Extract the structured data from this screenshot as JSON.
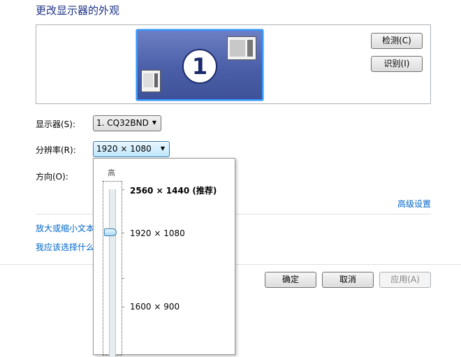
{
  "title": "更改显示器的外观",
  "buttons": {
    "detect": "检测(C)",
    "identify": "识别(I)",
    "ok": "确定",
    "cancel": "取消",
    "apply": "应用(A)"
  },
  "preview": {
    "monitor_number": "1"
  },
  "fields": {
    "display_label": "显示器(S):",
    "display_value": "1. CQ32BND",
    "resolution_label": "分辨率(R):",
    "resolution_value": "1920 × 1080",
    "orientation_label": "方向(O):"
  },
  "links": {
    "advanced": "高级设置",
    "text_size": "放大或缩小文本",
    "help": "我应该选择什么"
  },
  "dropdown": {
    "high_label": "高",
    "options": [
      "2560 × 1440 (推荐)",
      "1920 × 1080",
      "1600 × 900"
    ],
    "selected": "1920 × 1080"
  }
}
